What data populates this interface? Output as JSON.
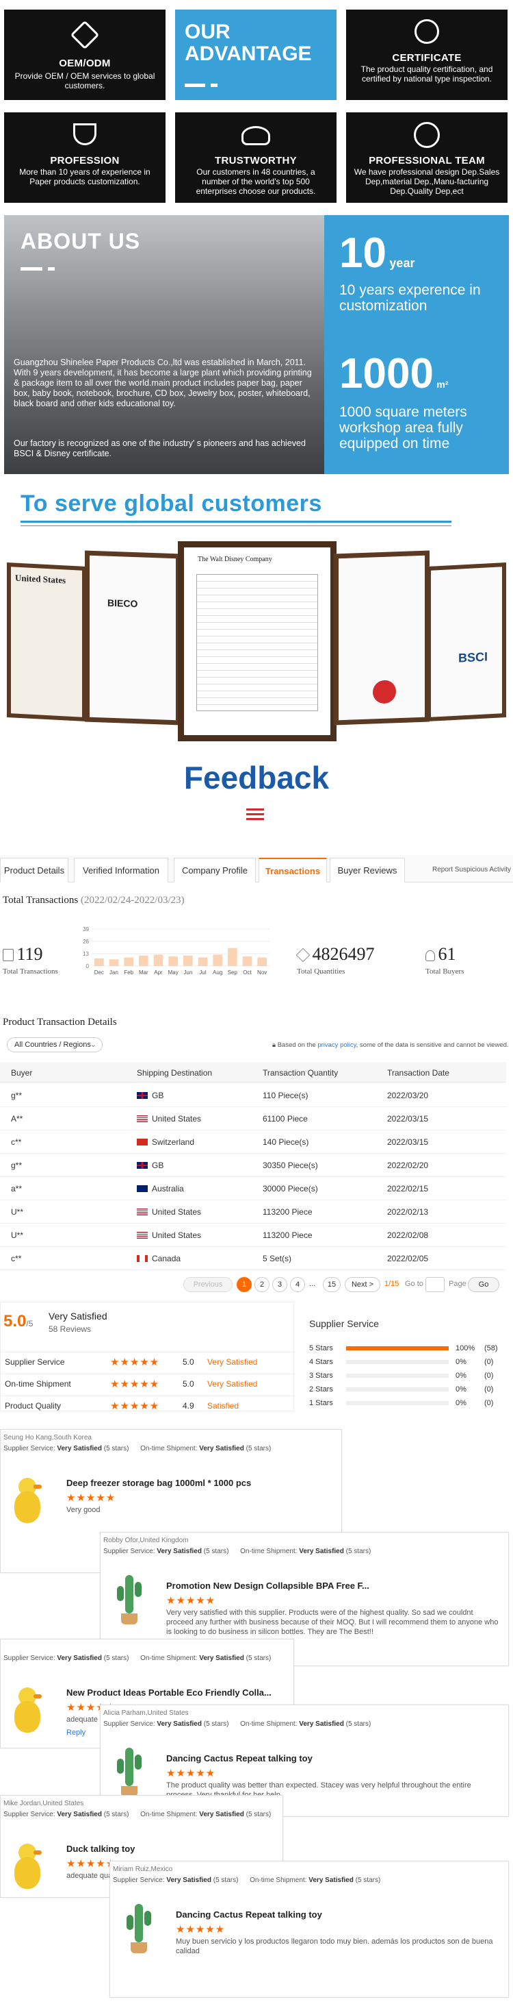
{
  "tiles": [
    {
      "title": "OEM/ODM",
      "desc": "Provide OEM / OEM services to global customers.",
      "icon": "pencil-ruler-icon"
    },
    {
      "title": "CERTIFICATE",
      "desc": "The product quality certification, and certified by national type inspection.",
      "icon": "certificate-icon"
    },
    {
      "title": "PROFESSION",
      "desc": "More than 10 years of experience in Paper products customization.",
      "icon": "trophy-icon"
    },
    {
      "title": "TRUSTWORTHY",
      "desc": "Our customers in 48 countries, a number of the world's top 500 enterprises choose our products.",
      "icon": "handshake-icon"
    },
    {
      "title": "PROFESSIONAL TEAM",
      "desc": "We have professional design Dep.Sales Dep,material Dep.,Manu-facturing Dep.Quality Dep,ect",
      "icon": "team-icon"
    }
  ],
  "advantage": {
    "line1": "OUR",
    "line2": "ADVANTAGE"
  },
  "about": {
    "title": "ABOUT US",
    "text1": "Guangzhou Shinelee Paper Products Co.,ltd was established in March, 2011. With 9 years development, it has become a large plant which providing printing & package item to all over the world.main product includes paper bag, paper box, baby book, notebook, brochure, CD box, Jewelry box, poster, whiteboard, black board and other kids educational toy.",
    "text2": "Our factory is recognized as one of the industry' s pioneers and has achieved BSCI & Disney certificate.",
    "stat1_num": "10",
    "stat1_unit": "year",
    "stat1_desc": "10 years experence in customization",
    "stat2_num": "1000",
    "stat2_unit": "m²",
    "stat2_desc": "1000 square meters workshop area fully equipped on time"
  },
  "serve_title": "To serve global customers",
  "certs": [
    "United States",
    "BIECO",
    "The Walt Disney Company",
    "",
    "BSCI"
  ],
  "feedback_title": "Feedback",
  "tabs": [
    "Product Details",
    "Verified Information",
    "Company Profile",
    "Transactions",
    "Buyer Reviews"
  ],
  "report_link": "Report Suspicious Activity",
  "transactions": {
    "title": "Total Transactions",
    "range": "(2022/02/24-2022/03/23)",
    "total": "119",
    "total_label": "Total Transactions",
    "qty": "4826497",
    "qty_label": "Total Quantities",
    "buyers": "61",
    "buyers_label": "Total Buyers"
  },
  "chart_data": {
    "type": "bar",
    "categories": [
      "Dec",
      "Jan",
      "Feb",
      "Mar",
      "Apr",
      "May",
      "Jun",
      "Jul",
      "Aug",
      "Sep",
      "Oct",
      "Nov"
    ],
    "values": [
      8,
      7,
      9,
      11,
      12,
      10,
      11,
      9,
      12,
      19,
      10,
      9
    ],
    "yticks": [
      "39",
      "26",
      "13",
      "0"
    ],
    "ylim": [
      0,
      39
    ],
    "color": "#fbd3b3"
  },
  "details": {
    "title": "Product Transaction Details",
    "filter": "All Countries / Regions",
    "note_pre": "Based on the",
    "note_link": "privacy policy",
    "note_post": ", some of the data is sensitive and cannot be viewed.",
    "headers": [
      "Buyer",
      "Shipping Destination",
      "Transaction Quantity",
      "Transaction Date"
    ],
    "rows": [
      {
        "buyer": "g**",
        "dest": "GB",
        "qty": "110 Piece(s)",
        "date": "2022/03/20",
        "flag": "gb"
      },
      {
        "buyer": "A**",
        "dest": "United States",
        "qty": "61100 Piece",
        "date": "2022/03/15",
        "flag": "us"
      },
      {
        "buyer": "c**",
        "dest": "Switzerland",
        "qty": "140 Piece(s)",
        "date": "2022/03/15",
        "flag": "ch"
      },
      {
        "buyer": "g**",
        "dest": "GB",
        "qty": "30350 Piece(s)",
        "date": "2022/02/20",
        "flag": "gb"
      },
      {
        "buyer": "a**",
        "dest": "Australia",
        "qty": "30000 Piece(s)",
        "date": "2022/02/15",
        "flag": "au"
      },
      {
        "buyer": "U**",
        "dest": "United States",
        "qty": "113200 Piece",
        "date": "2022/02/13",
        "flag": "us"
      },
      {
        "buyer": "U**",
        "dest": "United States",
        "qty": "113200 Piece",
        "date": "2022/02/08",
        "flag": "us"
      },
      {
        "buyer": "c**",
        "dest": "Canada",
        "qty": "5 Set(s)",
        "date": "2022/02/05",
        "flag": "ca"
      }
    ]
  },
  "pagination": {
    "prev": "Previous",
    "pages": [
      "1",
      "2",
      "3",
      "4",
      "...",
      "15"
    ],
    "next": "Next >",
    "count": "1/15",
    "goto": "Go to",
    "page": "Page",
    "go": "Go"
  },
  "rating": {
    "score": "5.0",
    "max": "/5",
    "label": "Very Satisfied",
    "reviews": "58 Reviews",
    "rows": [
      {
        "name": "Supplier Service",
        "score": "5.0",
        "text": "Very Satisfied"
      },
      {
        "name": "On-time Shipment",
        "score": "5.0",
        "text": "Very Satisfied"
      },
      {
        "name": "Product Quality",
        "score": "4.9",
        "text": "Satisfied"
      }
    ],
    "supplier_title": "Supplier Service",
    "bars": [
      {
        "label": "5 Stars",
        "pct": "100%",
        "count": "(58)",
        "fill": 1
      },
      {
        "label": "4 Stars",
        "pct": "0%",
        "count": "(0)",
        "fill": 0
      },
      {
        "label": "3 Stars",
        "pct": "0%",
        "count": "(0)",
        "fill": 0
      },
      {
        "label": "2 Stars",
        "pct": "0%",
        "count": "(0)",
        "fill": 0
      },
      {
        "label": "1 Stars",
        "pct": "0%",
        "count": "(0)",
        "fill": 0
      }
    ]
  },
  "reviews": [
    {
      "user": "Seung Ho Kang,South Korea",
      "ss": "Very Satisfied",
      "ts": "Very Satisfied",
      "product": "Deep freezer storage bag 1000ml * 1000 pcs",
      "comment": "Very good",
      "img": "duck"
    },
    {
      "user": "Robby Ofor,United Kingdom",
      "ss": "Very Satisfied",
      "ts": "Very Satisfied",
      "product": "Promotion New Design Collapsible BPA Free F...",
      "comment": "Very very satisfied with this supplier. Products were of the highest quality. So sad we couldnt proceed any further with business because of their MOQ. But I will recommend them to anyone who is looking to do business in silicon bottles. They are The Best!!",
      "img": "cactus"
    },
    {
      "user": "",
      "ss": "Very Satisfied",
      "ts": "Very Satisfied",
      "product": "New Product Ideas Portable Eco Friendly Colla...",
      "comment": "adequate quality",
      "img": "duck",
      "reply": "Reply"
    },
    {
      "user": "Alicia Parham,United States",
      "ss": "Very Satisfied",
      "ts": "Very Satisfied",
      "product": "Dancing Cactus Repeat talking toy",
      "comment": "The product quality was better than expected. Stacey was very helpful throughout the entire process. Very thankful for her help.",
      "img": "cactus"
    },
    {
      "user": "Mike Jordan,United States",
      "ss": "Very Satisfied",
      "ts": "Very Satisfied",
      "product": "Duck talking toy",
      "comment": "adequate quality",
      "img": "duck"
    },
    {
      "user": "Miriam Ruiz,Mexico",
      "ss": "Very Satisfied",
      "ts": "Very Satisfied",
      "product": "Dancing Cactus Repeat talking toy",
      "comment": "Muy buen servicio y los productos llegaron todo muy bien. además los productos son de buena calidad",
      "img": "cactus"
    }
  ],
  "review_labels": {
    "ss": "Supplier Service:",
    "ts": "On-time Shipment:",
    "stars": "(5 stars)"
  }
}
